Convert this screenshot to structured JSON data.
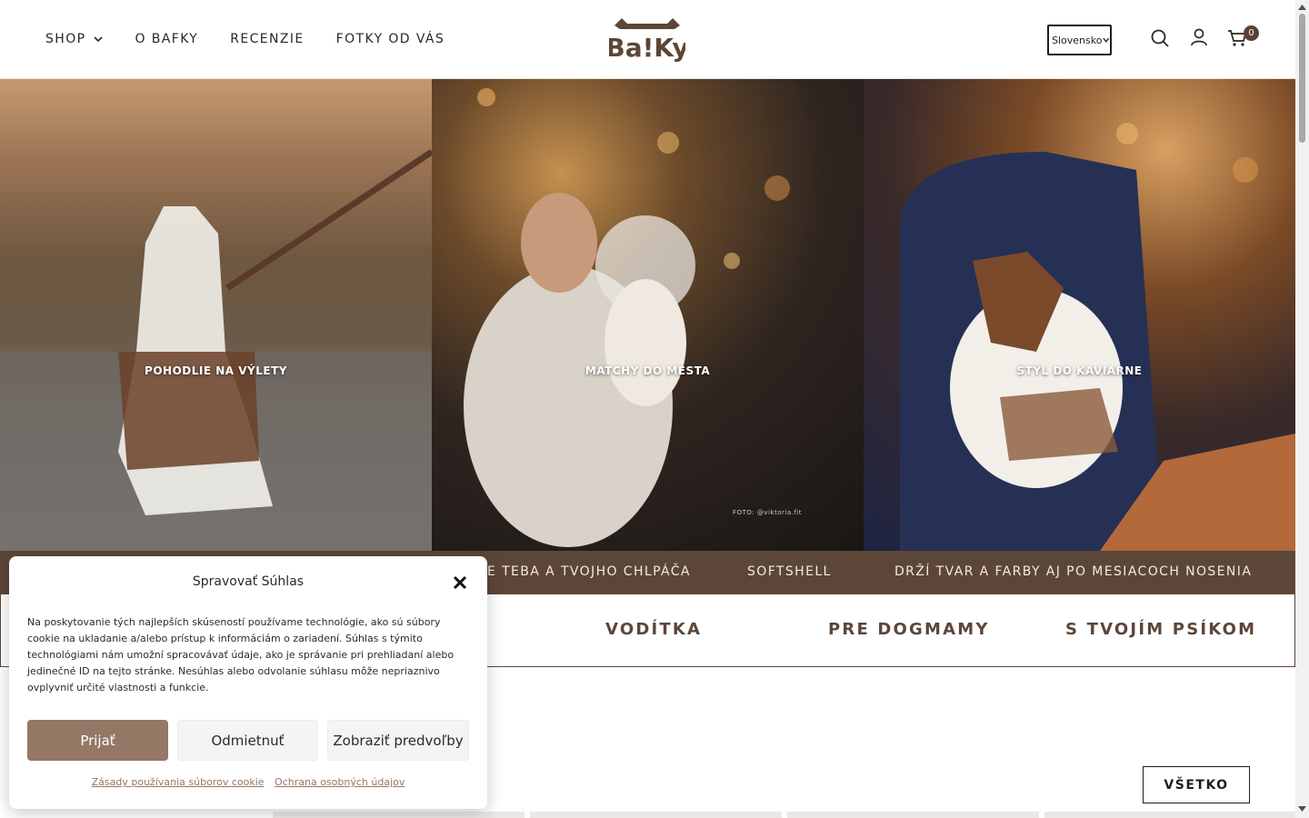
{
  "header": {
    "nav": [
      {
        "label": "SHOP",
        "has_dropdown": true
      },
      {
        "label": "O BAFKY"
      },
      {
        "label": "RECENZIE"
      },
      {
        "label": "FOTKY OD VÁS"
      }
    ],
    "logo_text": "Ba!Ky",
    "language_select": "Slovensko",
    "cart_count": "0",
    "icons": [
      "search-icon",
      "user-icon",
      "cart-icon"
    ]
  },
  "hero": {
    "panels": [
      {
        "label": "POHODLIE NA VÝLETY"
      },
      {
        "label": "MATCHY DO MESTA",
        "credit": "FOTO: @viktoria.fit"
      },
      {
        "label": "ŠTÝL DO KAVIARNE"
      }
    ]
  },
  "band": {
    "items": [
      "E TEBA A TVOJHO CHLPÁČA",
      "SOFTSHELL",
      "DRŽÍ TVAR A FARBY AJ PO MESIACOCH NOSENIA"
    ]
  },
  "categories": [
    "VODÍTKA",
    "PRE DOGMAMY",
    "S TVOJÍM PSÍKOM"
  ],
  "all_button": "VŠETKO",
  "cookie_modal": {
    "title": "Spravovať Súhlas",
    "text": "Na poskytovanie tých najlepších skúseností používame technológie, ako sú súbory cookie na ukladanie a/alebo prístup k informáciám o zariadení. Súhlas s týmito technológiami nám umožní spracovávať údaje, ako je správanie pri prehliadaní alebo jedinečné ID na tejto stránke. Nesúhlas alebo odvolanie súhlasu môže nepriaznivo ovplyvniť určité vlastnosti a funkcie.",
    "accept": "Prijať",
    "deny": "Odmietnuť",
    "preferences": "Zobraziť predvoľby",
    "link_cookies": "Zásady používania súborov cookie",
    "link_privacy": "Ochrana osobných údajov"
  },
  "colors": {
    "brand_brown": "#5c4638",
    "accept_button": "#957766"
  }
}
